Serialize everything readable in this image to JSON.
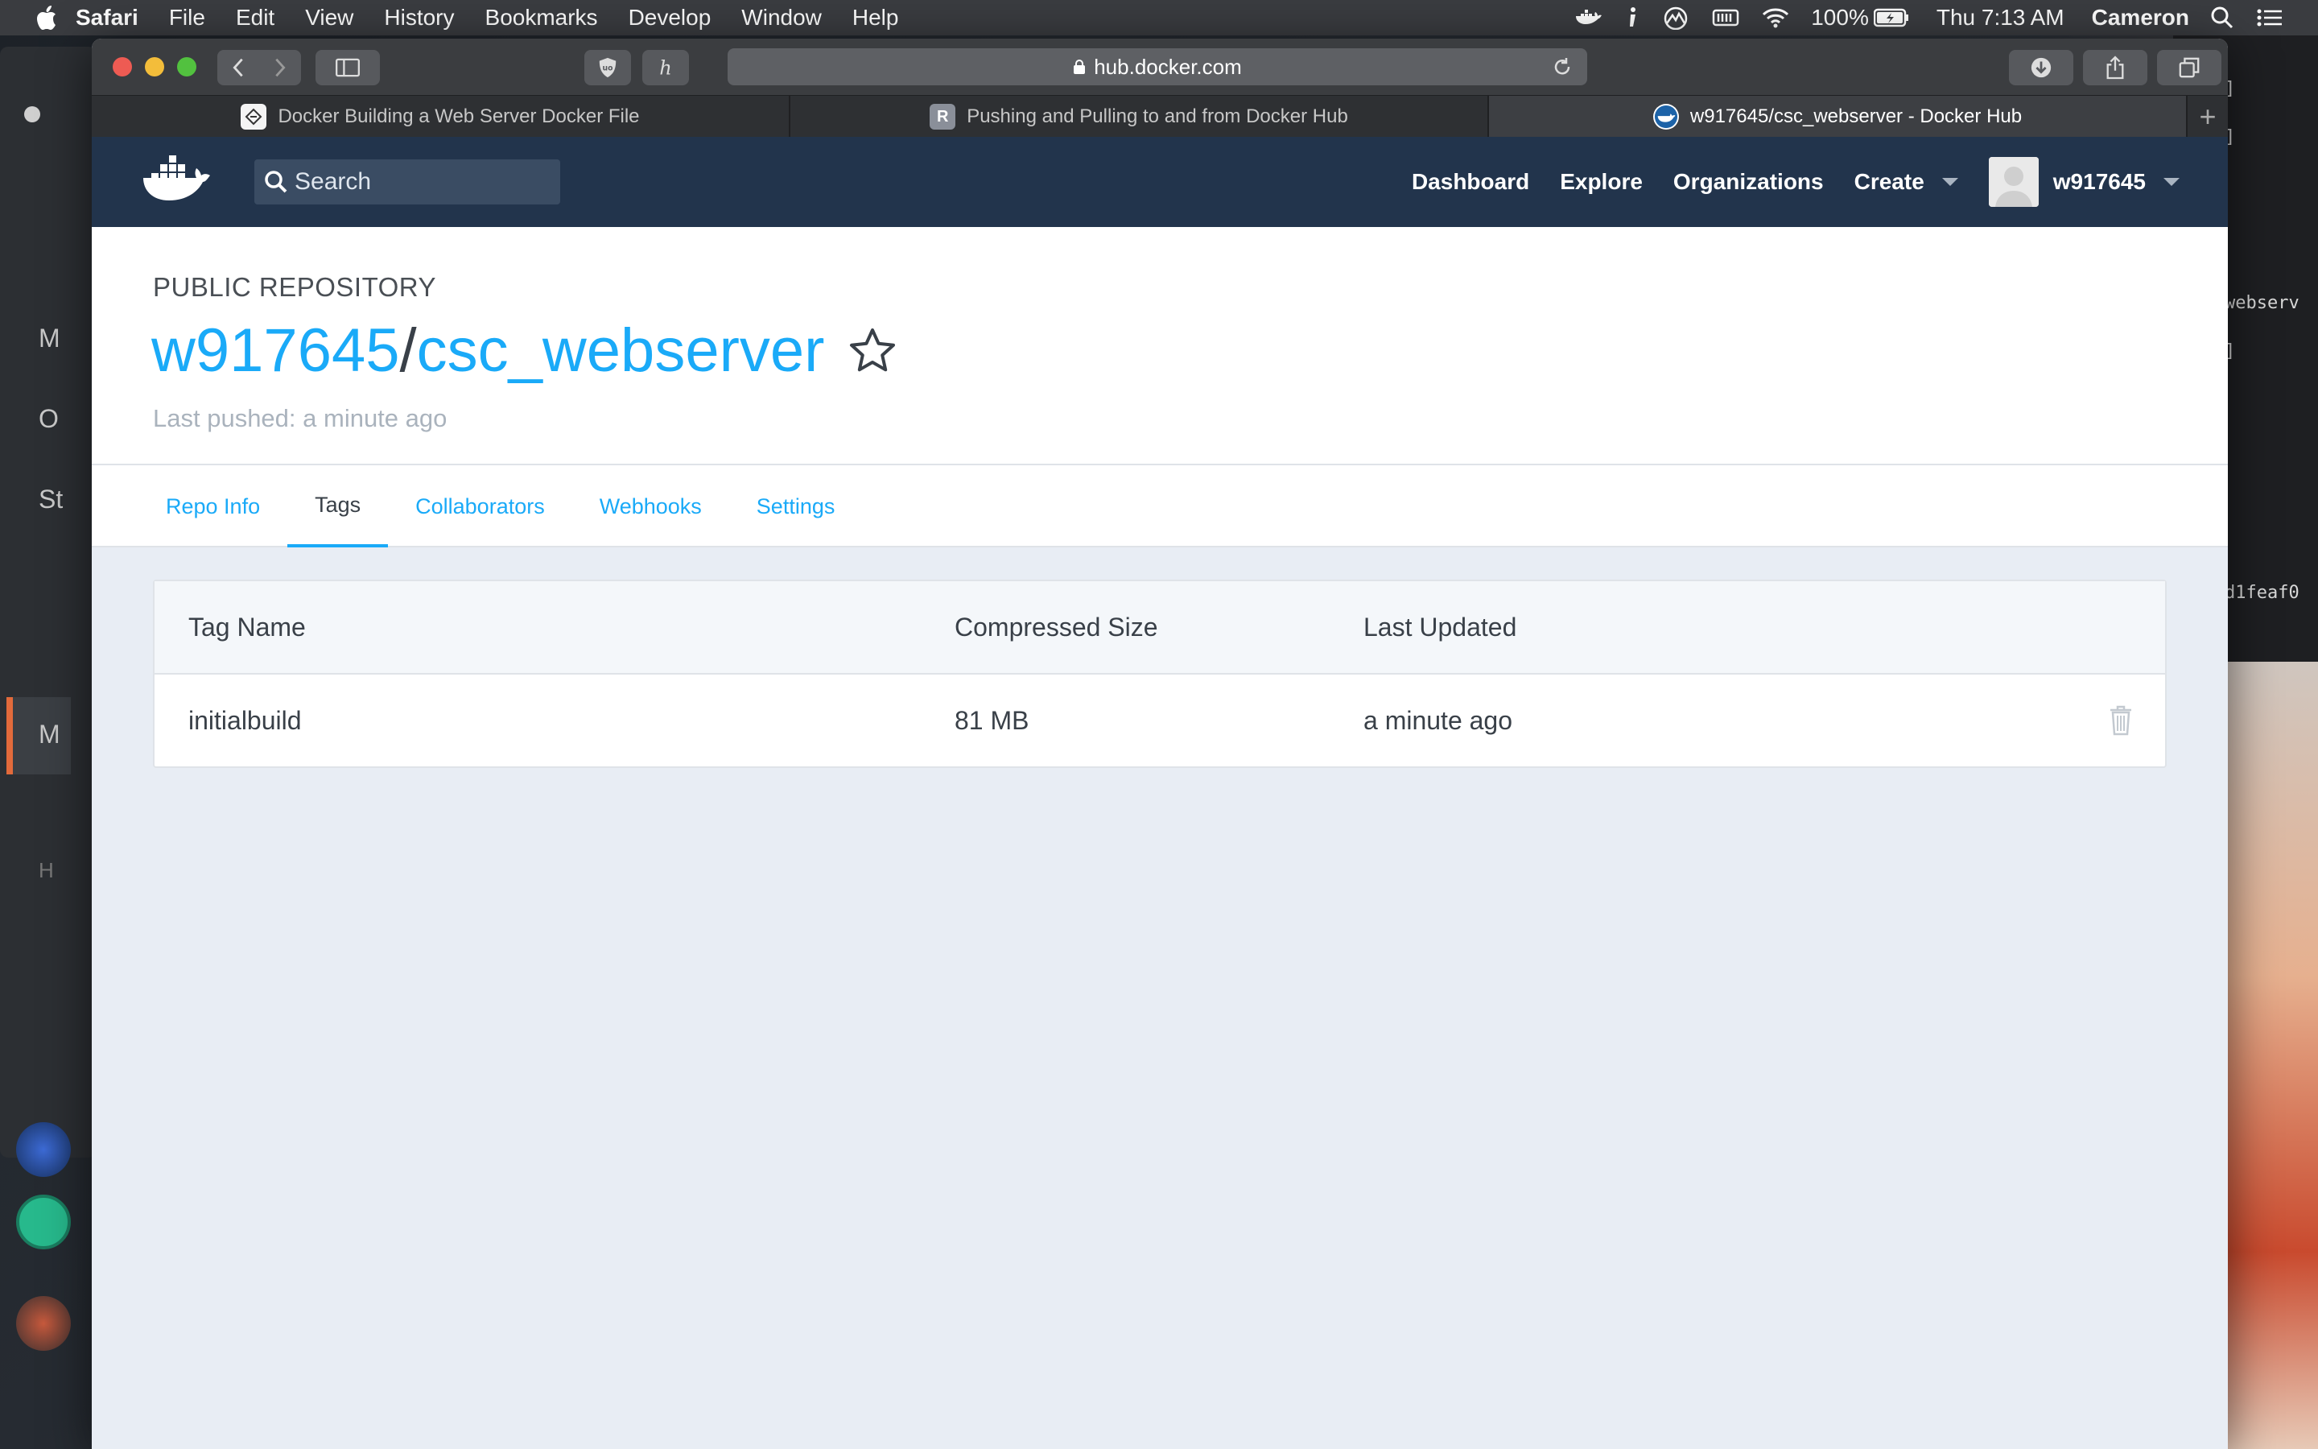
{
  "menubar": {
    "app": "Safari",
    "items": [
      "File",
      "Edit",
      "View",
      "History",
      "Bookmarks",
      "Develop",
      "Window",
      "Help"
    ],
    "battery": "100%",
    "clock": "Thu 7:13 AM",
    "user": "Cameron"
  },
  "background_windows": {
    "left_letters": [
      "M",
      "O",
      "St",
      "M",
      "H"
    ],
    "terminal_lines": [
      "]",
      "]",
      "webserv",
      "]",
      "d1feaf0"
    ]
  },
  "browser": {
    "url": "hub.docker.com",
    "tabs": [
      {
        "label": "Docker Building a Web Server Docker File",
        "favicon": "docker-doc-icon"
      },
      {
        "label": "Pushing and Pulling to and from Docker Hub",
        "favicon": "R"
      },
      {
        "label": "w917645/csc_webserver - Docker Hub",
        "favicon": "docker-hub-icon",
        "active": true
      }
    ]
  },
  "dockerhub": {
    "search_placeholder": "Search",
    "nav": {
      "dashboard": "Dashboard",
      "explore": "Explore",
      "organizations": "Organizations",
      "create": "Create",
      "username": "w917645"
    },
    "repo": {
      "label": "PUBLIC REPOSITORY",
      "owner": "w917645",
      "separator": "/",
      "name": "csc_webserver",
      "last_pushed": "Last pushed: a minute ago"
    },
    "tabs": [
      "Repo Info",
      "Tags",
      "Collaborators",
      "Webhooks",
      "Settings"
    ],
    "active_tab": "Tags",
    "table": {
      "headers": [
        "Tag Name",
        "Compressed Size",
        "Last Updated"
      ],
      "rows": [
        {
          "tag": "initialbuild",
          "size": "81 MB",
          "updated": "a minute ago"
        }
      ]
    },
    "colors": {
      "nav": "#22344c",
      "link": "#1aaaf8"
    }
  }
}
